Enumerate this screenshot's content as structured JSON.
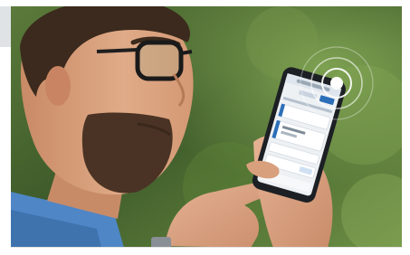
{
  "photo": {
    "subject": "man-using-smartphone",
    "palette": {
      "foliage_dark": "#2f4a22",
      "foliage_light": "#7ea24e",
      "skin": "#d9a07e",
      "beard": "#4a3324",
      "hair": "#3b2a1d",
      "shirt": "#4f86c6",
      "phone_body": "#1c1f24",
      "screen_bg": "#eef1f4",
      "app_accent": "#2c6fb8",
      "signal_ring": "#ffffff"
    }
  }
}
